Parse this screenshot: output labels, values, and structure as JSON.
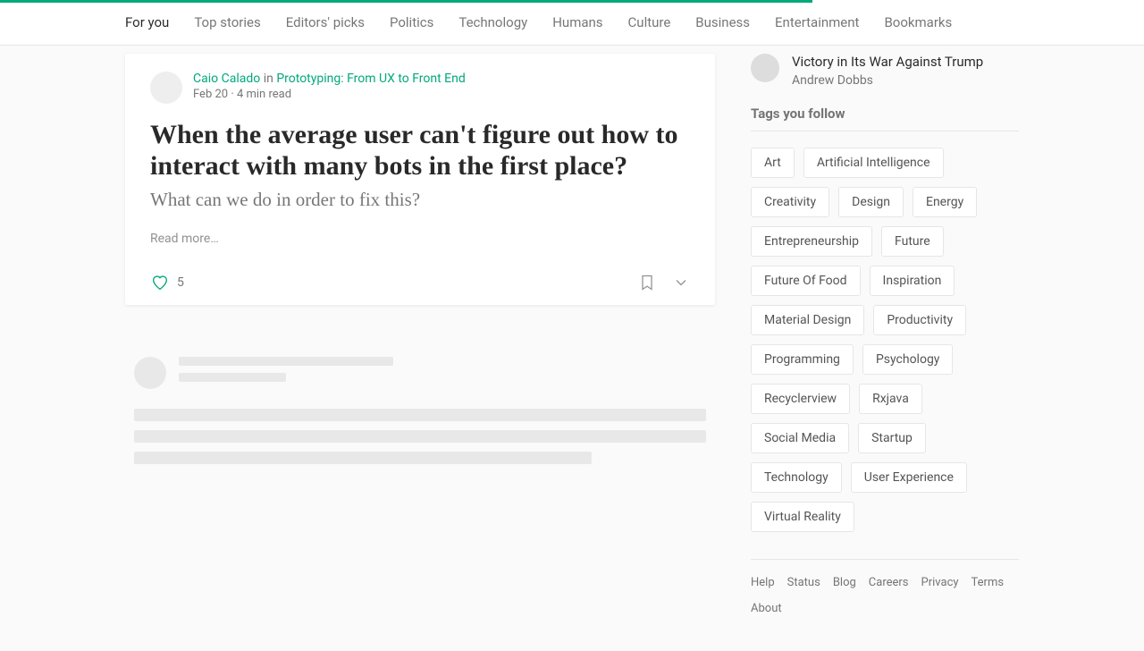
{
  "nav": {
    "items": [
      {
        "label": "For you",
        "active": true
      },
      {
        "label": "Top stories"
      },
      {
        "label": "Editors' picks"
      },
      {
        "label": "Politics"
      },
      {
        "label": "Technology"
      },
      {
        "label": "Humans"
      },
      {
        "label": "Culture"
      },
      {
        "label": "Business"
      },
      {
        "label": "Entertainment"
      },
      {
        "label": "Bookmarks"
      }
    ]
  },
  "article": {
    "author": "Caio Calado",
    "in": "in",
    "publication": "Prototyping: From UX to Front End",
    "date": "Feb 20",
    "read_time": "4 min read",
    "title": "When the average user can't figure out how to interact with many bots in the first place?",
    "subtitle": "What can we do in order to fix this?",
    "read_more": "Read more…",
    "likes": "5"
  },
  "sidebar": {
    "story": {
      "title": "Victory in Its War Against Trump",
      "author": "Andrew Dobbs"
    },
    "tags_heading": "Tags you follow",
    "tags": [
      "Art",
      "Artificial Intelligence",
      "Creativity",
      "Design",
      "Energy",
      "Entrepreneurship",
      "Future",
      "Future Of Food",
      "Inspiration",
      "Material Design",
      "Productivity",
      "Programming",
      "Psychology",
      "Recyclerview",
      "Rxjava",
      "Social Media",
      "Startup",
      "Technology",
      "User Experience",
      "Virtual Reality"
    ]
  },
  "footer": [
    "Help",
    "Status",
    "Blog",
    "Careers",
    "Privacy",
    "Terms",
    "About"
  ]
}
